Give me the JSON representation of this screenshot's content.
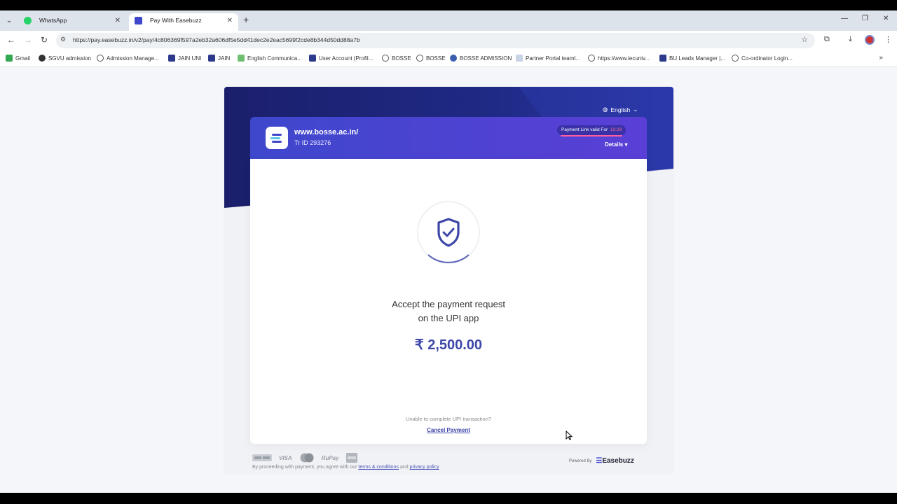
{
  "browser": {
    "tabs": [
      {
        "title": "WhatsApp",
        "active": false
      },
      {
        "title": "Pay With Easebuzz",
        "active": true
      }
    ],
    "url": "https://pay.easebuzz.in/v2/pay/4c806369f597a2eb32a606df5e5dd41dec2e2eac5699f2cde8b344d50dd88a7b",
    "bookmarks": [
      "Gmail",
      "SGVU admission",
      "Admission Manage...",
      "JAIN UNI",
      "JAIN",
      "English Communica...",
      "User Account (Profil...",
      "BOSSE",
      "BOSSE",
      "BOSSE ADMISSION",
      "Partner Portal teaml...",
      "https://www.iecuniv...",
      "BU Leads Manager |...",
      "Co-ordinator Login..."
    ]
  },
  "payment": {
    "language": "English",
    "merchant_site": "www.bosse.ac.in/",
    "transaction_id": "Tr ID 293276",
    "timer_label": "Payment Link valid For",
    "timer_value": "13:29",
    "details_label": "Details",
    "instruction_line1": "Accept the payment request",
    "instruction_line2": "on the UPI app",
    "amount": "₹ 2,500.00",
    "unable_text": "Unable to complete UPI transaction?",
    "cancel_label": "Cancel Payment",
    "payment_methods": [
      "VISA",
      "RuPay"
    ],
    "terms_prefix": "By proceeding with payment, you agree with our",
    "terms_link": "terms & conditions",
    "terms_and": "and",
    "privacy_link": "privacy policy",
    "powered_by": "Powered By",
    "brand": "Easebuzz"
  },
  "colors": {
    "hero_dark": "#1b1f6b",
    "merchant_gradient_start": "#3e47cc",
    "accent": "#3d47a8",
    "timer_highlight": "#ff6f9a"
  }
}
